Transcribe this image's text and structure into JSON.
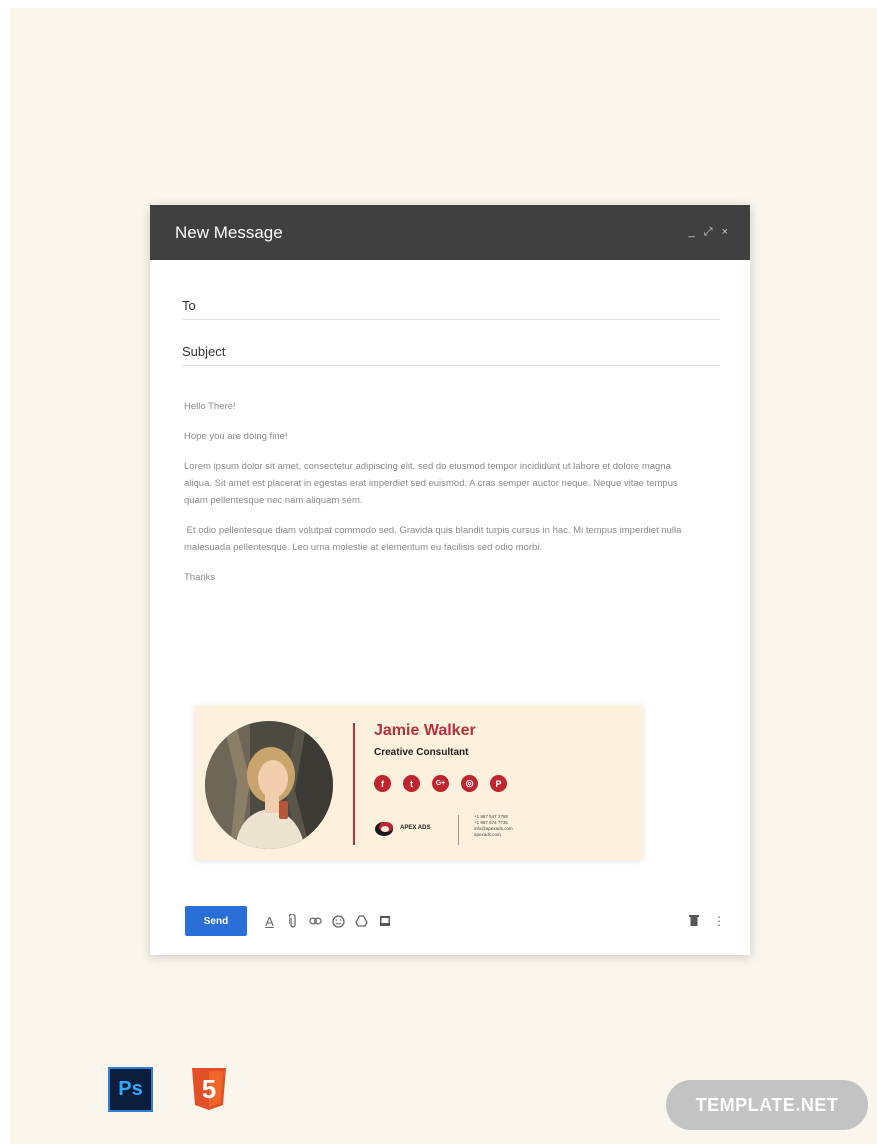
{
  "window": {
    "title": "New Message",
    "controls": {
      "minimize": "_",
      "expand": "⤢",
      "close": "×"
    }
  },
  "fields": {
    "to_label": "To",
    "subject_label": "Subject"
  },
  "body": {
    "greeting": "Hello There!",
    "line1": "Hope you are doing fine!",
    "para1": "Lorem ipsum dolor sit amet, consectetur adipiscing elit, sed do eiusmod tempor incididunt ut labore et dolore magna aliqua. Sit amet est placerat in egestas erat imperdiet sed euismod. A cras semper auctor neque. Neque vitae tempus quam pellentesque nec nam aliquam sem.",
    "para2": " Et odio pellentesque diam volutpat commodo sed. Gravida quis blandit turpis cursus in hac. Mi tempus imperdiet nulla malesuada pellentesque. Leo urna molestie at elementum eu facilisis sed odio morbi.",
    "closing": "Thanks"
  },
  "signature": {
    "name": "Jamie Walker",
    "title": "Creative Consultant",
    "socials": [
      {
        "icon": "facebook-icon",
        "glyph": "f"
      },
      {
        "icon": "twitter-icon",
        "glyph": "t"
      },
      {
        "icon": "google-plus-icon",
        "glyph": "G+"
      },
      {
        "icon": "instagram-icon",
        "glyph": "◎"
      },
      {
        "icon": "pinterest-icon",
        "glyph": "P"
      }
    ],
    "company": "APEX ADS",
    "contact": {
      "phone1": "+1 987 547 2768",
      "phone2": "+1 987 674 7736",
      "email": "info@apexads.com",
      "website": "apexads.com"
    },
    "accent_color": "#b5323c"
  },
  "toolbar": {
    "send_label": "Send",
    "tools": [
      "format-text-icon",
      "attach-icon",
      "link-icon",
      "emoji-icon",
      "drive-icon",
      "photo-icon"
    ],
    "right": [
      "trash-icon",
      "more-options-icon"
    ]
  },
  "footer": {
    "ps_label": "Ps",
    "html5_label": "5",
    "brand": "TEMPLATE.NET"
  }
}
